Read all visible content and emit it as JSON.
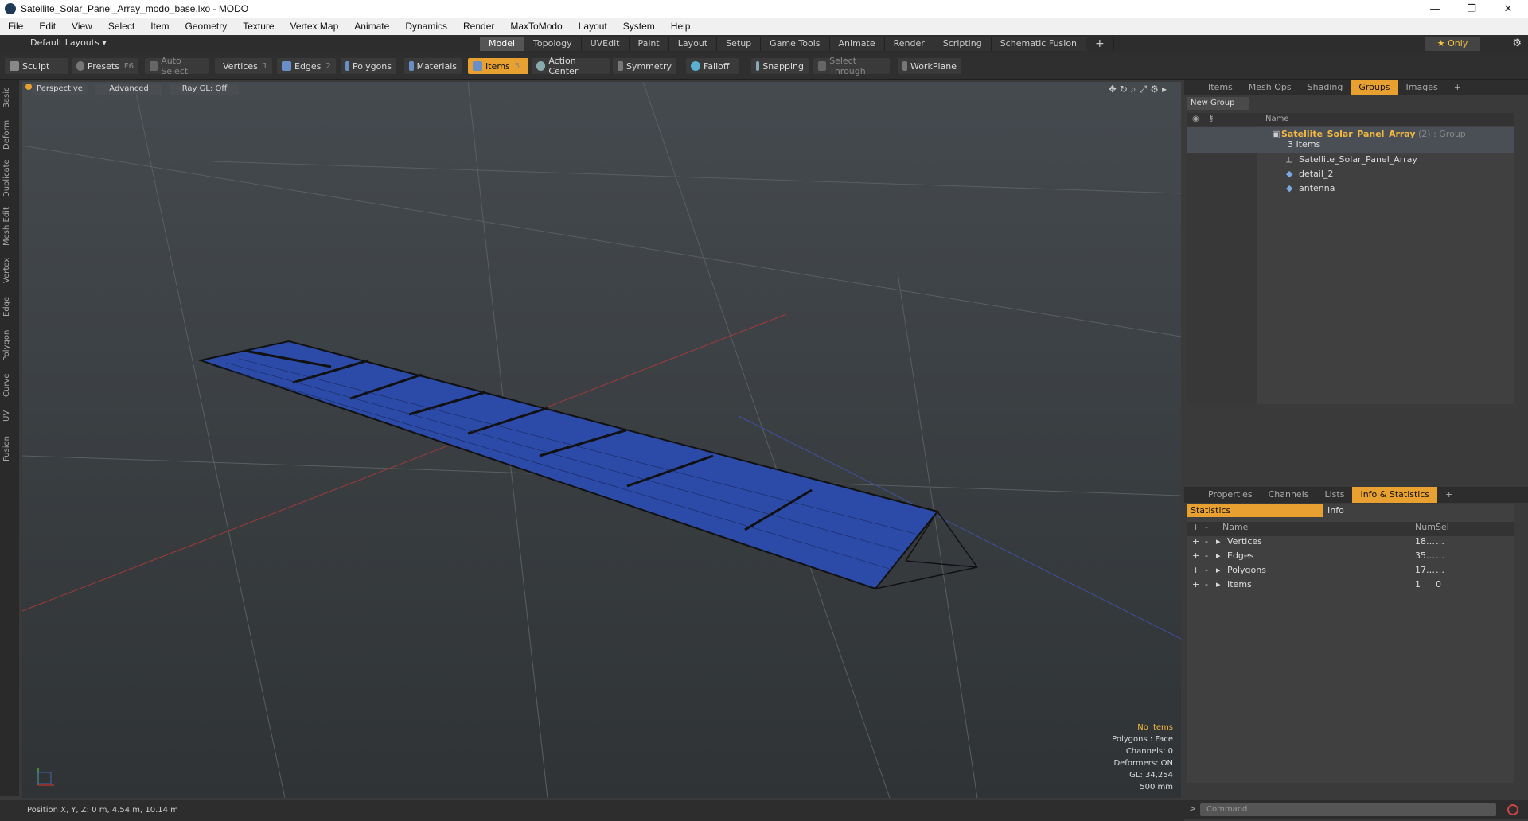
{
  "window": {
    "title": "Satellite_Solar_Panel_Array_modo_base.lxo - MODO"
  },
  "menu": [
    "File",
    "Edit",
    "View",
    "Select",
    "Item",
    "Geometry",
    "Texture",
    "Vertex Map",
    "Animate",
    "Dynamics",
    "Render",
    "MaxToModo",
    "Layout",
    "System",
    "Help"
  ],
  "layout": {
    "selector": "Default Layouts ▾"
  },
  "mode_tabs": [
    "Model",
    "Topology",
    "UVEdit",
    "Paint",
    "Layout",
    "Setup",
    "Game Tools",
    "Animate",
    "Render",
    "Scripting",
    "Schematic Fusion"
  ],
  "only_label": "★  Only",
  "toolbar": {
    "sculpt": "Sculpt",
    "presets": "Presets",
    "presets_key": "F6",
    "auto_select": "Auto Select",
    "vertices": "Vertices",
    "vertices_num": "1",
    "edges": "Edges",
    "edges_num": "2",
    "polygons": "Polygons",
    "materials": "Materials",
    "items": "Items",
    "items_num": "5",
    "action_center": "Action Center",
    "symmetry": "Symmetry",
    "falloff": "Falloff",
    "snapping": "Snapping",
    "select_through": "Select Through",
    "workplane": "WorkPlane"
  },
  "left_tabs": [
    "Basic",
    "Deform",
    "Duplicate",
    "Mesh Edit",
    "Vertex",
    "Edge",
    "Polygon",
    "Curve",
    "UV",
    "Fusion"
  ],
  "viewport": {
    "perspective": "Perspective",
    "advanced": "Advanced",
    "raygl": "Ray GL: Off",
    "overlay": [
      "No Items",
      "Polygons : Face",
      "Channels: 0",
      "Deformers: ON",
      "GL: 34,254",
      "500 mm"
    ]
  },
  "status": "Position X, Y, Z:  0 m, 4.54 m, 10.14 m",
  "top_panel_tabs": [
    "Items",
    "Mesh Ops",
    "Shading",
    "Groups",
    "Images"
  ],
  "groups": {
    "new_group": "New Group",
    "name_header": "Name",
    "root": "Satellite_Solar_Panel_Array",
    "root_suffix": "(2) : Group",
    "root_count": "3 Items",
    "children": [
      "Satellite_Solar_Panel_Array",
      "detail_2",
      "antenna"
    ]
  },
  "bottom_panel_tabs": [
    "Properties",
    "Channels",
    "Lists",
    "Info & Statistics"
  ],
  "stats": {
    "tab_statistics": "Statistics",
    "tab_info": "Info",
    "col_name": "Name",
    "col_num": "Num",
    "col_sel": "Sel",
    "rows": [
      {
        "name": "Vertices",
        "num": "18…",
        "sel": "…"
      },
      {
        "name": "Edges",
        "num": "35…",
        "sel": "…"
      },
      {
        "name": "Polygons",
        "num": "17…",
        "sel": "…"
      },
      {
        "name": "Items",
        "num": "1",
        "sel": "0"
      }
    ]
  },
  "command": {
    "placeholder": "Command"
  },
  "colors": {
    "accent": "#e8a030",
    "panel": "#1f3fa0",
    "grid": "#5a5f63"
  }
}
